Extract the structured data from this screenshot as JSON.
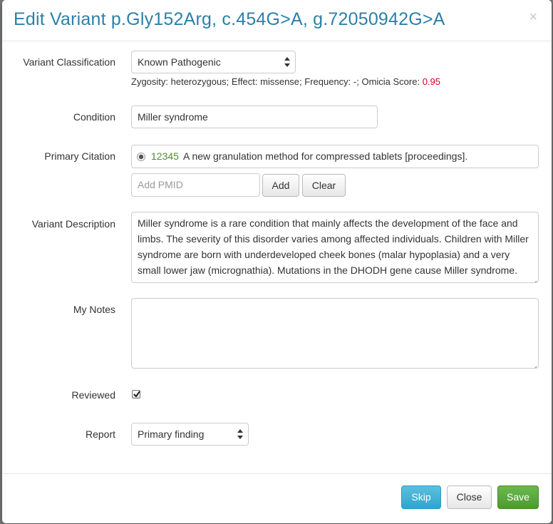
{
  "header": {
    "title": "Edit Variant p.Gly152Arg, c.454G>A, g.72050942G>A",
    "close_glyph": "×"
  },
  "classification": {
    "label": "Variant Classification",
    "selected": "Known Pathogenic",
    "help_text": "Zygosity: heterozygous; Effect: missense; Frequency: -; Omicia Score: ",
    "score": "0.95",
    "score_color": "#d0021b"
  },
  "condition": {
    "label": "Condition",
    "value": "Miller syndrome"
  },
  "citation": {
    "label": "Primary Citation",
    "pmid": "12345",
    "text": "A new granulation method for compressed tablets [proceedings].",
    "add_pmid_placeholder": "Add PMID",
    "add_label": "Add",
    "clear_label": "Clear"
  },
  "description": {
    "label": "Variant Description",
    "text": "Miller syndrome is a rare condition that mainly affects the development of the face and limbs. The severity of this disorder varies among affected individuals. Children with Miller syndrome are born with underdeveloped cheek bones (malar hypoplasia) and a very small lower jaw (micrognathia). Mutations in the DHODH gene cause Miller syndrome. This"
  },
  "notes": {
    "label": "My Notes",
    "value": ""
  },
  "reviewed": {
    "label": "Reviewed",
    "checked": true
  },
  "report": {
    "label": "Report",
    "selected": "Primary finding"
  },
  "footer": {
    "skip_label": "Skip",
    "close_label": "Close",
    "save_label": "Save"
  },
  "colors": {
    "title": "#2c80a8",
    "pmid": "#4f8a3a",
    "skip": "#5bc0de",
    "save": "#5cb85c"
  },
  "icons": [
    "close-icon",
    "select-arrows-icon",
    "radio-selected-icon",
    "checkmark-icon",
    "resize-grip-icon"
  ]
}
